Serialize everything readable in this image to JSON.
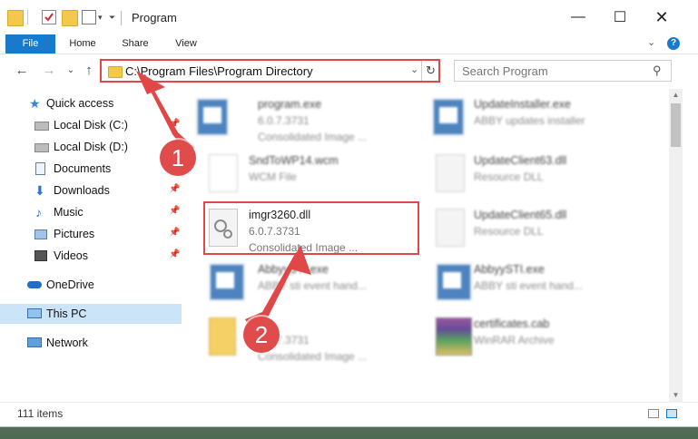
{
  "window": {
    "title": "Program"
  },
  "ribbon": {
    "file": "File",
    "home": "Home",
    "share": "Share",
    "view": "View",
    "help": "?"
  },
  "address": {
    "path": "C:\\Program Files\\Program Directory"
  },
  "search": {
    "placeholder": "Search Program"
  },
  "nav": {
    "quick_access": "Quick access",
    "items": [
      {
        "label": "Local Disk (C:)"
      },
      {
        "label": "Local Disk (D:)"
      },
      {
        "label": "Documents"
      },
      {
        "label": "Downloads"
      },
      {
        "label": "Music"
      },
      {
        "label": "Pictures"
      },
      {
        "label": "Videos"
      }
    ],
    "onedrive": "OneDrive",
    "thispc": "This PC",
    "network": "Network"
  },
  "files": [
    {
      "name": "program.exe",
      "line2": "6.0.7.3731",
      "line3": "Consolidated Image ...",
      "icon": "exe-icon"
    },
    {
      "name": "UpdateInstaller.exe",
      "line2": "ABBY updates installer",
      "line3": "",
      "icon": "exe-icon"
    },
    {
      "name": "SndToWP14.wcm",
      "line2": "WCM File",
      "line3": "",
      "icon": "file-icon"
    },
    {
      "name": "UpdateClient63.dll",
      "line2": "Resource DLL",
      "line3": "",
      "icon": "dll-icon"
    },
    {
      "name": "imgr3260.dll",
      "line2": "6.0.7.3731",
      "line3": "Consolidated Image ...",
      "icon": "dll-icon"
    },
    {
      "name": "UpdateClient65.dll",
      "line2": "Resource DLL",
      "line3": "",
      "icon": "dll-icon"
    },
    {
      "name": "AbbyySTI.exe",
      "line2": "ABBY sti event hand...",
      "line3": "",
      "icon": "exe-icon"
    },
    {
      "name": "AbbyySTI.exe",
      "line2": "ABBY sti event hand...",
      "line3": "",
      "icon": "exe-icon"
    },
    {
      "name": "",
      "line2": "6.0.7.3731",
      "line3": "Consolidated Image ...",
      "icon": "folder-icon"
    },
    {
      "name": "certificates.cab",
      "line2": "WinRAR Archive",
      "line3": "",
      "icon": "rar-icon"
    }
  ],
  "status": {
    "count": "111 items"
  },
  "annotations": {
    "step1": "1",
    "step2": "2"
  },
  "colors": {
    "accent": "#1979ca",
    "highlight": "#e04848"
  }
}
